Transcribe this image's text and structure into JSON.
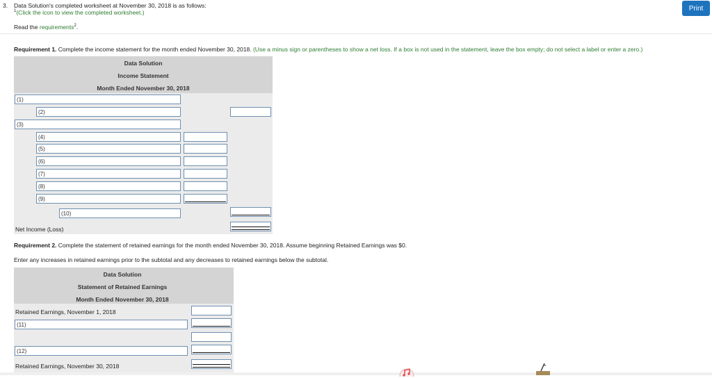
{
  "question": {
    "number": "3.",
    "text": "Data Solution's completed worksheet at November 30, 2018 is as follows:",
    "footnote_marker": "1",
    "click_note": "(Click the icon to view the completed worksheet.)",
    "read_prefix": "Read the ",
    "read_link": "requirements",
    "read_marker": "2",
    "read_suffix": "."
  },
  "print_button": "Print",
  "req1": {
    "title": "Requirement 1.",
    "text": " Complete the income statement for the month ended November 30, 2018. ",
    "note": "(Use a minus sign or parentheses to show a net loss. If a box is not used in the statement, leave the box empty; do not select a label or enter a zero.)"
  },
  "income_statement": {
    "company": "Data Solution",
    "title": "Income Statement",
    "period": "Month Ended November 30, 2018",
    "fields": [
      "(1)",
      "(2)",
      "(3)",
      "(4)",
      "(5)",
      "(6)",
      "(7)",
      "(8)",
      "(9)",
      "(10)"
    ],
    "net_income_label": "Net Income (Loss)"
  },
  "req2": {
    "title": "Requirement 2.",
    "text": " Complete the statement of retained earnings for the month ended November 30, 2018. Assume beginning Retained Earnings was $0.",
    "subtext": "Enter any increases in retained earnings prior to the subtotal and any decreases to retained earnings below the subtotal."
  },
  "retained_statement": {
    "company": "Data Solution",
    "title": "Statement of Retained Earnings",
    "period": "Month Ended November 30, 2018",
    "beginning_label": "Retained Earnings, November 1, 2018",
    "fields": [
      "(11)",
      "(12)"
    ],
    "ending_label": "Retained Earnings, November 30, 2018"
  },
  "icons": {
    "music": "music-note-icon",
    "pencil": "pencil-icon"
  }
}
